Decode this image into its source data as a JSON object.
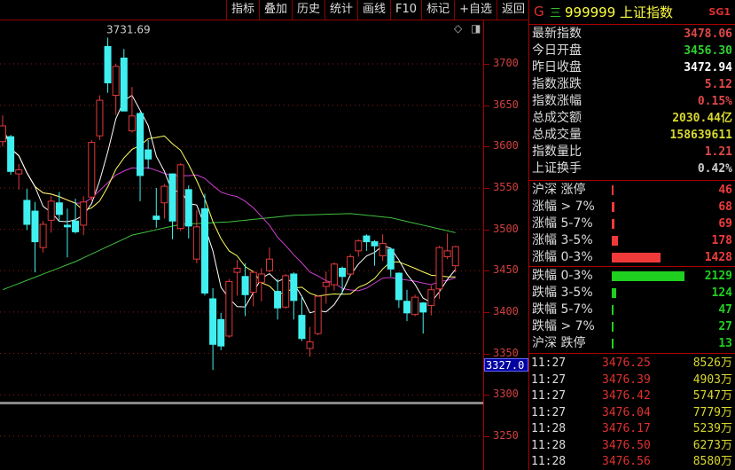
{
  "toolbar": {
    "buttons": [
      "指标",
      "叠加",
      "历史",
      "统计",
      "画线",
      "F10",
      "标记",
      "+自选",
      "返回"
    ]
  },
  "colors": {
    "up": "#e03a3a",
    "down": "#40f0f0",
    "ma5": "#ffffff",
    "ma10": "#ffff60",
    "ma20": "#d040d0",
    "ma60": "#40c040",
    "grid": "#8b1a1a"
  },
  "chart_data": {
    "type": "candlestick",
    "ylim": [
      3225,
      3760
    ],
    "y_ticks": [
      3700,
      3650,
      3600,
      3550,
      3500,
      3450,
      3400,
      3350,
      3300,
      3250
    ],
    "high_label": "3731.69",
    "crosshair_price": "3327.0",
    "candles": [
      [
        3606,
        3638,
        3600,
        3625
      ],
      [
        3612,
        3614,
        3566,
        3570
      ],
      [
        3567,
        3579,
        3548,
        3572
      ],
      [
        3535,
        3549,
        3499,
        3506
      ],
      [
        3522,
        3533,
        3448,
        3485
      ],
      [
        3478,
        3510,
        3472,
        3506
      ],
      [
        3511,
        3540,
        3496,
        3534
      ],
      [
        3532,
        3545,
        3509,
        3518
      ],
      [
        3505,
        3525,
        3466,
        3503
      ],
      [
        3510,
        3537,
        3495,
        3497
      ],
      [
        3505,
        3540,
        3493,
        3533
      ],
      [
        3539,
        3608,
        3534,
        3605
      ],
      [
        3613,
        3662,
        3608,
        3656
      ],
      [
        3721,
        3731.69,
        3665,
        3677
      ],
      [
        3662,
        3700,
        3638,
        3697
      ],
      [
        3707,
        3718,
        3643,
        3643
      ],
      [
        3619,
        3672,
        3617,
        3637
      ],
      [
        3640,
        3642,
        3534,
        3565
      ],
      [
        3596,
        3608,
        3573,
        3585
      ],
      [
        3516,
        3550,
        3502,
        3512
      ],
      [
        3532,
        3555,
        3513,
        3552
      ],
      [
        3567,
        3567,
        3488,
        3510
      ],
      [
        3501,
        3580,
        3498,
        3578
      ],
      [
        3548,
        3553,
        3489,
        3504
      ],
      [
        3464,
        3523,
        3459,
        3503
      ],
      [
        3525,
        3543,
        3420,
        3423
      ],
      [
        3416,
        3429,
        3330,
        3361
      ],
      [
        3391,
        3399,
        3354,
        3359
      ],
      [
        3371,
        3440,
        3369,
        3437
      ],
      [
        3448,
        3463,
        3420,
        3453
      ],
      [
        3443,
        3459,
        3395,
        3421
      ],
      [
        3424,
        3450,
        3407,
        3448
      ],
      [
        3436,
        3453,
        3413,
        3446
      ],
      [
        3450,
        3478,
        3448,
        3464
      ],
      [
        3425,
        3440,
        3391,
        3405
      ],
      [
        3406,
        3446,
        3404,
        3444
      ],
      [
        3446,
        3448,
        3391,
        3414
      ],
      [
        3396,
        3419,
        3365,
        3368
      ],
      [
        3356,
        3382,
        3346,
        3364
      ],
      [
        3374,
        3420,
        3372,
        3419
      ],
      [
        3431,
        3449,
        3410,
        3436
      ],
      [
        3433,
        3460,
        3426,
        3458
      ],
      [
        3453,
        3455,
        3421,
        3443
      ],
      [
        3446,
        3470,
        3444,
        3467
      ],
      [
        3474,
        3488,
        3467,
        3486
      ],
      [
        3492,
        3494,
        3474,
        3485
      ],
      [
        3485,
        3487,
        3456,
        3480
      ],
      [
        3468,
        3494,
        3462,
        3483
      ],
      [
        3476,
        3478,
        3443,
        3452
      ],
      [
        3447,
        3448,
        3405,
        3415
      ],
      [
        3413,
        3427,
        3389,
        3399
      ],
      [
        3397,
        3421,
        3395,
        3418
      ],
      [
        3411,
        3412,
        3374,
        3400
      ],
      [
        3408,
        3432,
        3396,
        3427
      ],
      [
        3428,
        3480,
        3416,
        3478
      ],
      [
        3467,
        3495,
        3464,
        3474
      ],
      [
        3456,
        3480,
        3448,
        3479
      ]
    ],
    "ma_long": {
      "index": [
        0,
        9,
        16,
        22,
        28,
        36,
        43,
        48,
        56
      ],
      "values": [
        3427,
        3461,
        3493,
        3506,
        3509,
        3517,
        3519,
        3514,
        3496
      ]
    }
  },
  "panel": {
    "code": "999999",
    "name": "上证指数",
    "g": "G",
    "menu_icon": "三",
    "sg": "SG1",
    "stats": [
      {
        "label": "最新指数",
        "value": "3478.06",
        "color": "#e04848"
      },
      {
        "label": "今日开盘",
        "value": "3456.30",
        "color": "#30d030"
      },
      {
        "label": "昨日收盘",
        "value": "3472.94",
        "color": "#ffffff"
      },
      {
        "label": "指数涨跌",
        "value": "5.12",
        "color": "#e04848"
      },
      {
        "label": "指数涨幅",
        "value": "0.15%",
        "color": "#e04848"
      },
      {
        "label": "总成交额",
        "value": "2030.44亿",
        "color": "#d8d830"
      },
      {
        "label": "总成交量",
        "value": "158639611",
        "color": "#d8d830"
      },
      {
        "label": "指数量比",
        "value": "1.21",
        "color": "#e04848"
      },
      {
        "label": "上证换手",
        "value": "0.42%",
        "color": "#cccccc"
      }
    ],
    "up": [
      {
        "label": "沪深 涨停",
        "count": 46
      },
      {
        "label": "涨幅 > 7%",
        "count": 68
      },
      {
        "label": "涨幅 5-7%",
        "count": 69
      },
      {
        "label": "涨幅 3-5%",
        "count": 178
      },
      {
        "label": "涨幅 0-3%",
        "count": 1428
      }
    ],
    "down": [
      {
        "label": "跌幅 0-3%",
        "count": 2129
      },
      {
        "label": "跌幅 3-5%",
        "count": 124
      },
      {
        "label": "跌幅 5-7%",
        "count": 47
      },
      {
        "label": "跌幅 > 7%",
        "count": 27
      },
      {
        "label": "沪深 跌停",
        "count": 13
      }
    ],
    "ticks": [
      {
        "time": "11:27",
        "price": "3476.25",
        "vol": "8526万"
      },
      {
        "time": "11:27",
        "price": "3476.39",
        "vol": "4903万"
      },
      {
        "time": "11:27",
        "price": "3476.42",
        "vol": "5747万"
      },
      {
        "time": "11:27",
        "price": "3476.04",
        "vol": "7779万"
      },
      {
        "time": "11:28",
        "price": "3476.17",
        "vol": "5239万"
      },
      {
        "time": "11:28",
        "price": "3476.50",
        "vol": "6273万"
      },
      {
        "time": "11:28",
        "price": "3476.56",
        "vol": "8580万"
      }
    ]
  }
}
